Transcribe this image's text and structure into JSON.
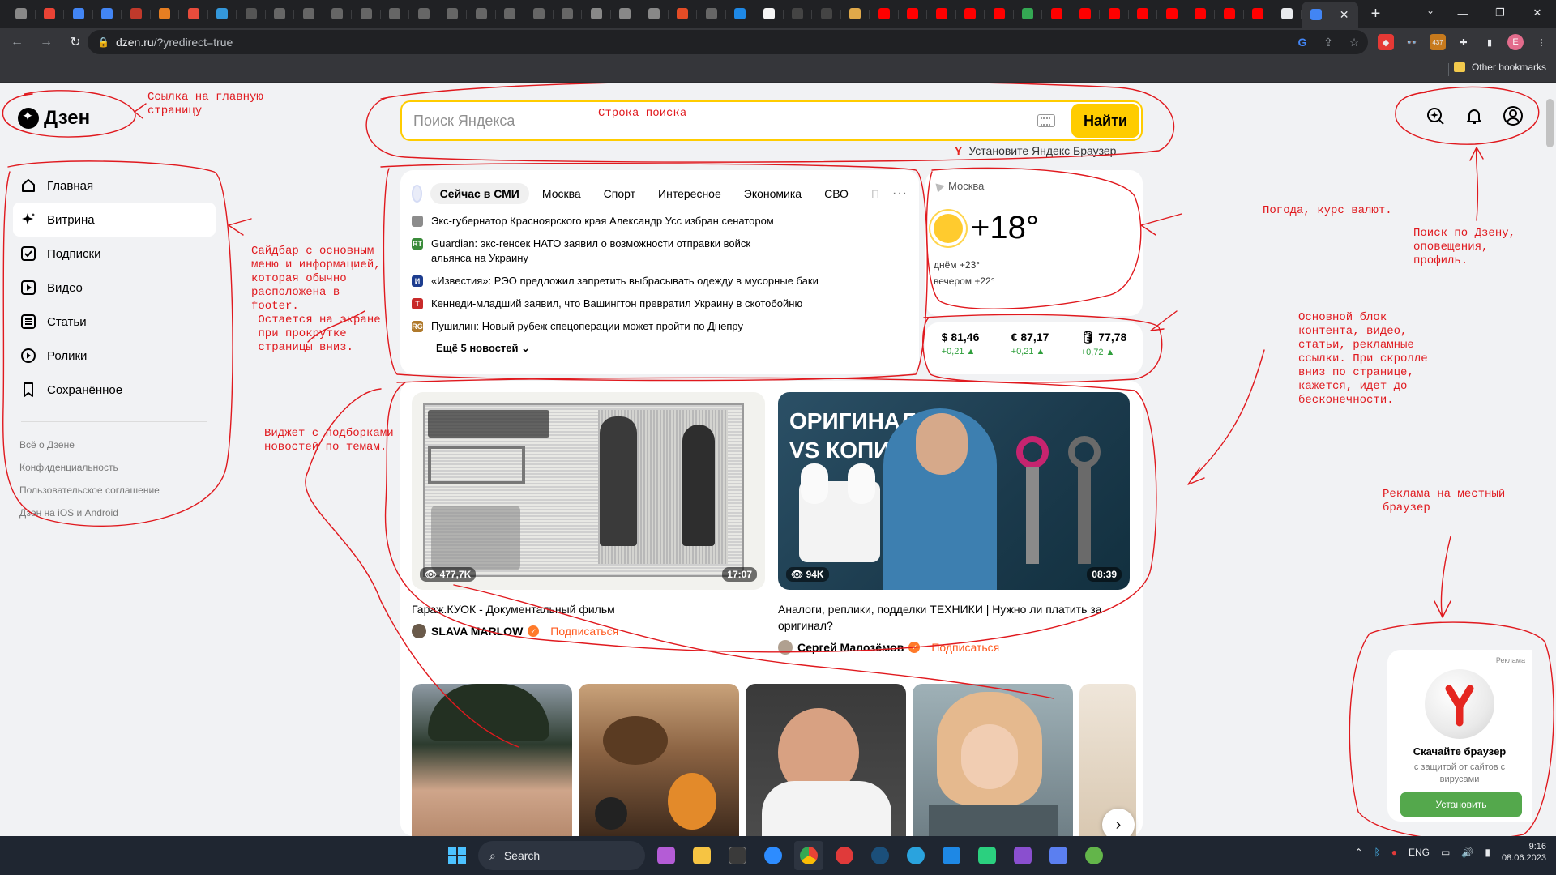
{
  "browser": {
    "tab_favicon_colors": [
      "#888",
      "#ea4335",
      "#4285f4",
      "#4285f4",
      "#c0392b",
      "#e67e22",
      "#e74c3c",
      "#3498db",
      "#555",
      "#666",
      "#666",
      "#666",
      "#666",
      "#666",
      "#666",
      "#666",
      "#666",
      "#666",
      "#666",
      "#666",
      "#888",
      "#888",
      "#888",
      "#e34c26",
      "#666",
      "#1e88e5",
      "#f5f5f5",
      "#444",
      "#444",
      "#e0a94a",
      "#ff0000",
      "#ff0000",
      "#ff0000",
      "#ff0000",
      "#ff0000",
      "#34a853",
      "#ff0000",
      "#ff0000",
      "#ff0000",
      "#ff0000",
      "#ff0000",
      "#ff0000",
      "#ff0000",
      "#ff0000",
      "#e8eaed",
      "#4285f4"
    ],
    "url_host": "dzen.ru",
    "url_path": "/?yredirect=true",
    "extension_avatar": "E",
    "extension_badge": "437",
    "bookmarks_other": "Other bookmarks"
  },
  "header": {
    "logo_text": "Дзен",
    "search_placeholder": "Поиск Яндекса",
    "search_button": "Найти",
    "install_browser": "Установите Яндекс Браузер"
  },
  "sidebar": {
    "items": [
      {
        "label": "Главная",
        "icon": "home-icon"
      },
      {
        "label": "Витрина",
        "icon": "sparkle-icon"
      },
      {
        "label": "Подписки",
        "icon": "subscriptions-icon"
      },
      {
        "label": "Видео",
        "icon": "play-icon"
      },
      {
        "label": "Статьи",
        "icon": "article-icon"
      },
      {
        "label": "Ролики",
        "icon": "clips-icon"
      },
      {
        "label": "Сохранённое",
        "icon": "bookmark-icon"
      }
    ],
    "footer": [
      "Всё о Дзене",
      "Конфиденциальность",
      "Пользовательское соглашение",
      "Дзен на iOS и Android"
    ]
  },
  "news": {
    "tabs": [
      "Сейчас в СМИ",
      "Москва",
      "Спорт",
      "Интересное",
      "Экономика",
      "СВО",
      "П"
    ],
    "items": [
      {
        "source_color": "#8c8c8c",
        "source_mark": "",
        "text": "Экс-губернатор Красноярского края Александр Усс избран сенатором"
      },
      {
        "source_color": "#3a8b3a",
        "source_mark": "RT",
        "text": "Guardian: экс-генсек НАТО заявил о возможности отправки войск альянса на Украину"
      },
      {
        "source_color": "#1d3d8f",
        "source_mark": "И",
        "text": "«Известия»: РЭО предложил запретить выбрасывать одежду в мусорные баки"
      },
      {
        "source_color": "#c82a2a",
        "source_mark": "Т",
        "text": "Кеннеди-младший заявил, что Вашингтон превратил Украину в скотобойню"
      },
      {
        "source_color": "#b07a2c",
        "source_mark": "RG",
        "text": "Пушилин: Новый рубеж спецоперации может пройти по Днепру"
      }
    ],
    "more": "Ещё 5 новостей"
  },
  "weather": {
    "city": "Москва",
    "temp": "+18°",
    "day": "днём +23°",
    "evening": "вечером +22°"
  },
  "currency": [
    {
      "value": "$ 81,46",
      "delta": "+0,21 ▲"
    },
    {
      "value": "€ 87,17",
      "delta": "+0,21 ▲"
    },
    {
      "value": "🛢 77,78",
      "delta": "+0,72 ▲"
    }
  ],
  "feed": [
    {
      "views": "477,7K",
      "duration": "17:07",
      "title": "Гараж.КУОК - Документальный фильм",
      "author": "SLAVA MARLOW",
      "subscribe": "Подписаться"
    },
    {
      "views": "94K",
      "duration": "08:39",
      "title": "Аналоги, реплики, подделки ТЕХНИКИ | Нужно ли платить за оригинал?",
      "author": "Сергей Малозёмов",
      "subscribe": "Подписаться",
      "thumb_caption": "ОРИГИНАЛ\nVS КОПИЯ"
    }
  ],
  "ad": {
    "label": "Реклама",
    "title": "Скачайте браузер",
    "subtitle": "с защитой от сайтов с вирусами",
    "button": "Установить"
  },
  "annotations": {
    "logo": "Ссылка на главную\nстраницу",
    "search": "Строка поиска",
    "sidebar": "Сайдбар с основным\nменю и информацией,\nкоторая обычно\nрасположена в\nfooter.\n Остается на экране\n при прокрутке\n страницы вниз.",
    "widget": "Виджет с подборками\nновостей по темам.",
    "weather": "Погода, курс валют.",
    "profile": "Поиск по Дзену,\nоповещения,\nпрофиль.",
    "content": "Основной блок\nконтента, видео,\nстатьи, рекламные\nссылки. При скролле\nвниз по странице,\nкажется, идет до\nбесконечности.",
    "ad": "Реклама на местный\nбраузер"
  },
  "taskbar": {
    "search": "Search",
    "lang": "ENG",
    "time": "9:16",
    "date": "08.06.2023"
  }
}
